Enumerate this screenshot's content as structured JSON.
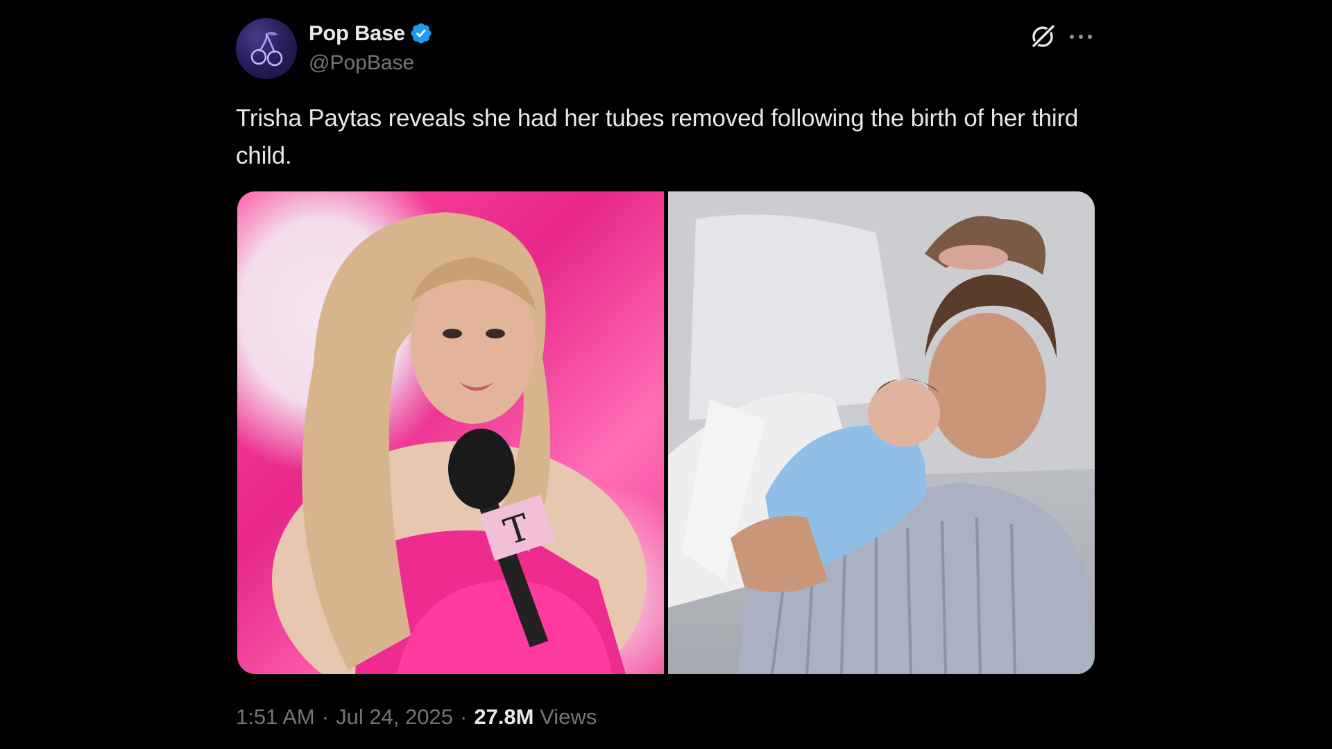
{
  "author": {
    "display_name": "Pop Base",
    "handle": "@PopBase",
    "verified": true,
    "avatar_icon": "cherries-icon",
    "badge_color": "#1d9bf0"
  },
  "actions": {
    "grok_icon": "grok-icon",
    "more_icon": "more-options-icon"
  },
  "tweet": {
    "text": "Trisha Paytas reveals she had her tubes removed following the birth of her third child."
  },
  "media": [
    {
      "description_icon": "photo",
      "alt": ""
    },
    {
      "description_icon": "photo",
      "alt": ""
    }
  ],
  "meta": {
    "time": "1:51 AM",
    "separator": "·",
    "date": "Jul 24, 2025",
    "views_count": "27.8M",
    "views_label": "Views"
  },
  "colors": {
    "background": "#000000",
    "text_primary": "#e7e9ea",
    "text_secondary": "#71767b",
    "accent": "#1d9bf0"
  }
}
